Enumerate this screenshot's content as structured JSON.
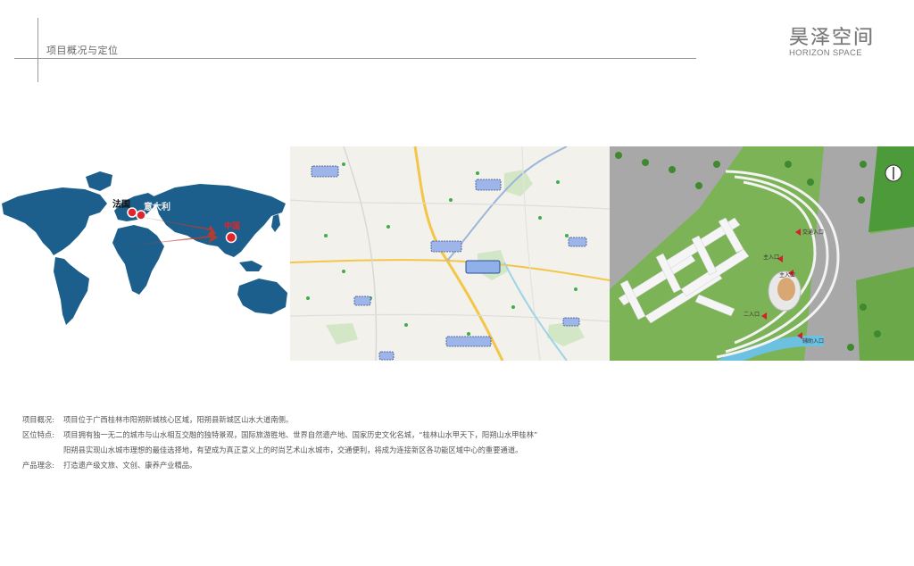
{
  "header": {
    "section_title": "项目概况与定位",
    "brand_cn": "昊泽空间",
    "brand_en": "HORIZON SPACE"
  },
  "world_map": {
    "labels": {
      "france": "法国",
      "italy": "意大利",
      "china": "中国"
    },
    "colors": {
      "land": "#1d5f8c",
      "marker": "#e0252b",
      "arrow": "#c0392b"
    }
  },
  "site_plan": {
    "entrances": {
      "main": "主入口",
      "main2": "主入口",
      "second": "二入口",
      "auxiliary": "辅助入口",
      "transport": "交通入口"
    }
  },
  "description": {
    "overview_label": "项目概况:",
    "overview_text": "项目位于广西桂林市阳朔新城核心区域，阳朔县新城区山水大道南侧。",
    "location_label": "区位特点:",
    "location_text_1": "项目拥有独一无二的城市与山水相互交融的独特景观，国际旅游胜地、世界自然遗产地、国家历史文化名城，“桂林山水甲天下，阳朔山水甲桂林”",
    "location_text_2": "阳朔县实现山水城市理想的最佳选择地，有望成为真正意义上的时尚艺术山水城市，交通便利，将成为连接新区各功能区域中心的重要通道。",
    "concept_label": "产品理念:",
    "concept_text": "打造遗产级文旅、文创、康养产业精品。"
  }
}
